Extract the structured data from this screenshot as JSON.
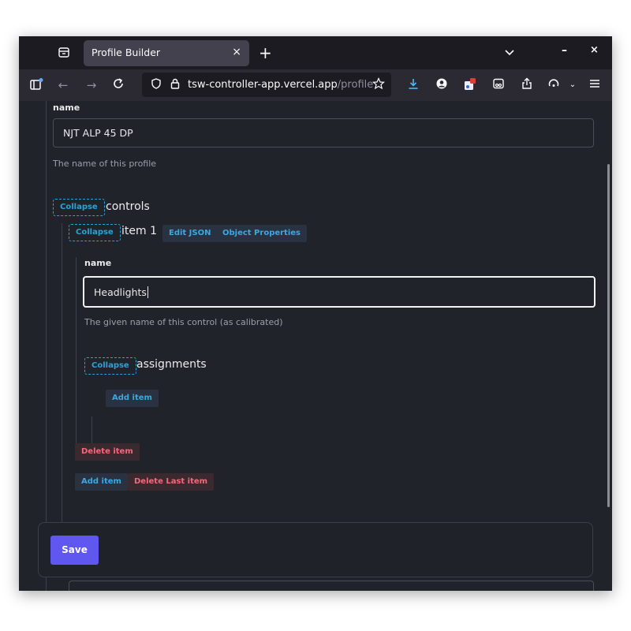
{
  "browser": {
    "tab_title": "Profile Builder",
    "tab_close": "×",
    "new_tab": "+",
    "min": "–",
    "close": "×",
    "url_host": "tsw-controller-app.vercel.app",
    "url_path": "/profile",
    "icons": [
      "tab-list-icon",
      "back-icon",
      "forward-icon",
      "reload-icon",
      "shield-icon",
      "lock-icon",
      "bookmark-star-icon",
      "download-icon",
      "account-icon",
      "extension-icon",
      "reader-icon",
      "share-icon",
      "sync-icon",
      "menu-icon"
    ]
  },
  "form": {
    "name_label": "name",
    "name_value": "NJT ALP 45 DP",
    "name_help": "The name of this profile",
    "controls": {
      "collapse_label": "Collapse",
      "title": "controls",
      "item": {
        "collapse_label": "Collapse",
        "title": "item 1",
        "edit_json_label": "Edit JSON",
        "object_props_label": "Object Properties",
        "name_label": "name",
        "name_value": "Headlights",
        "name_help": "The given name of this control (as calibrated)",
        "assignments": {
          "collapse_label": "Collapse",
          "title": "assignments",
          "add_item_label": "Add item"
        },
        "delete_item_label": "Delete item"
      },
      "add_item_label": "Add item",
      "delete_last_label": "Delete Last item"
    },
    "save_label": "Save"
  },
  "colors": {
    "accent_blue": "#29a3d6",
    "danger_red": "#f06a78",
    "save_purple": "#6056f0",
    "page_bg": "#20232a"
  }
}
